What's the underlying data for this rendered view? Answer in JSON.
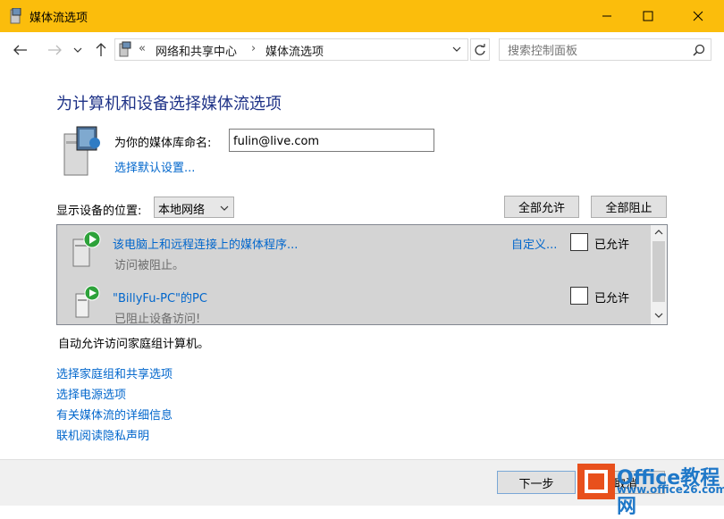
{
  "window": {
    "title": "媒体流选项"
  },
  "nav": {
    "breadcrumb_sep": "«",
    "breadcrumb": [
      "网络和共享中心",
      "媒体流选项"
    ],
    "arrow": "›",
    "search_placeholder": "搜索控制面板"
  },
  "main": {
    "heading": "为计算机和设备选择媒体流选项",
    "library_label": "为你的媒体库命名:",
    "library_value": "fulin@live.com",
    "default_settings_link": "选择默认设置...",
    "show_devices_label": "显示设备的位置:",
    "location_value": "本地网络",
    "allow_all_button": "全部允许",
    "block_all_button": "全部阻止"
  },
  "devices": [
    {
      "name": "该电脑上和远程连接上的媒体程序...",
      "status": "访问被阻止。",
      "customize": "自定义...",
      "allowed_label": "已允许"
    },
    {
      "name": "\"BillyFu-PC\"的PC",
      "status": "已阻止设备访问!",
      "allowed_label": "已允许"
    }
  ],
  "homegroup_text": "自动允许访问家庭组计算机。",
  "links": [
    "选择家庭组和共享选项",
    "选择电源选项",
    "有关媒体流的详细信息",
    "联机阅读隐私声明"
  ],
  "footer": {
    "next_button": "下一步",
    "cancel_button": "取消"
  },
  "watermark": {
    "line1": "Office教程网",
    "line2": "www.office26.com"
  },
  "colors": {
    "titlebar": "#fbbd0c",
    "heading": "#1e3287",
    "link": "#0066cc"
  }
}
